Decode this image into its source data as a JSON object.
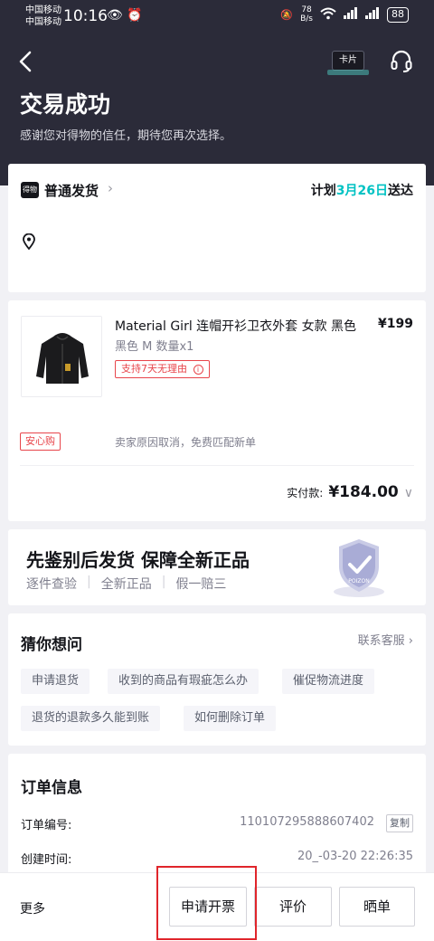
{
  "status_bar": {
    "carrier1": "中国移动",
    "carrier2": "中国移动",
    "time": "10:16",
    "net_speed_value": "78",
    "net_speed_unit": "B/s",
    "battery": "88"
  },
  "header": {
    "card_label": "卡片",
    "title": "交易成功",
    "subtitle": "感谢您对得物的信任，期待您再次选择。"
  },
  "shipping": {
    "logo_text": "得物",
    "type": "普通发货",
    "plan_prefix": "计划",
    "plan_date": "3月26日",
    "plan_suffix": "送达"
  },
  "product": {
    "name": "Material Girl 连帽开衫卫衣外套 女款 黑色",
    "price": "¥199",
    "spec": "黑色 M 数量x1",
    "return_tag": "支持7天无理由",
    "safe_tag": "安心购",
    "safe_text": "卖家原因取消，免费匹配新单",
    "paid_label": "实付款:",
    "paid_amount": "¥184.00"
  },
  "auth": {
    "main": "先鉴别后发货  保障全新正品",
    "items": [
      "逐件查验",
      "全新正品",
      "假一赔三"
    ],
    "shield_text": "POIZON"
  },
  "guess": {
    "title": "猜你想问",
    "contact": "联系客服",
    "questions": [
      "申请退货",
      "收到的商品有瑕疵怎么办",
      "催促物流进度",
      "退货的退款多久能到账",
      "如何删除订单"
    ]
  },
  "order": {
    "title": "订单信息",
    "number_label": "订单编号:",
    "number_value": "110107295888607402",
    "copy": "复制",
    "created_label": "创建时间:",
    "created_value": "20_-03-20 22:26:35"
  },
  "bottom_bar": {
    "more": "更多",
    "invoice": "申请开票",
    "review": "评价",
    "share": "晒单"
  },
  "colors": {
    "header_bg": "#2b2b39",
    "accent_green": "#01c2c3",
    "tag_red": "#e8454b",
    "highlight_red": "#e0252b"
  }
}
